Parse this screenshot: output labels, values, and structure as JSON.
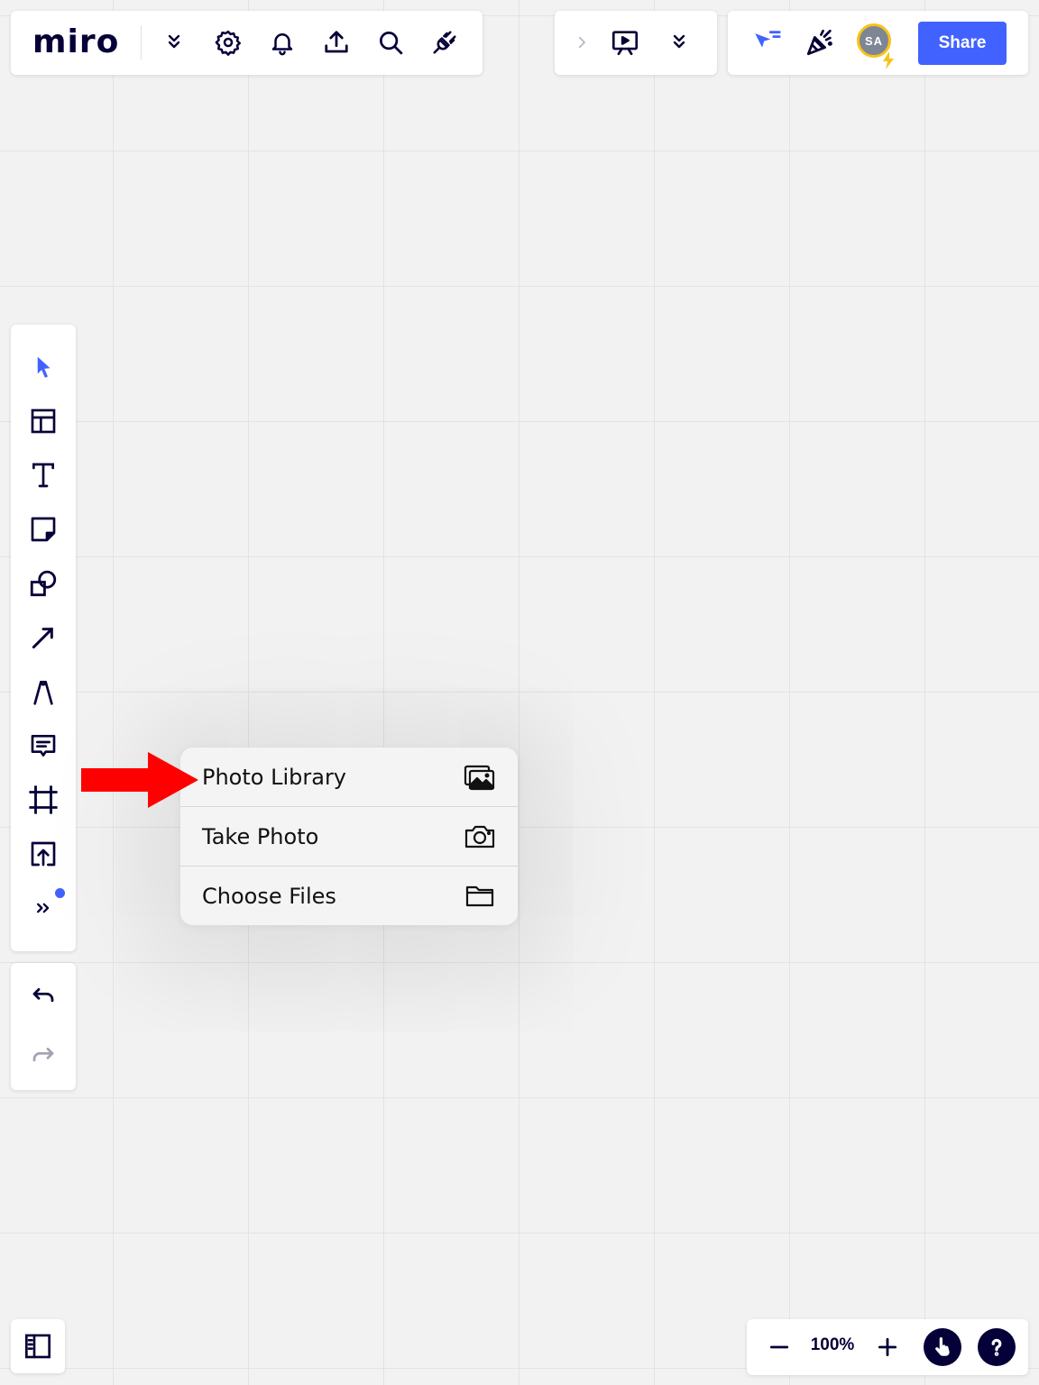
{
  "topbar": {
    "logo": "miro",
    "icons": [
      "chevrons-down-icon",
      "settings-gear-icon",
      "bell-icon",
      "upload-icon",
      "search-icon",
      "plug-icon"
    ]
  },
  "presentation": {
    "icons": [
      "chevron-right-icon",
      "presentation-play-icon",
      "chevrons-down-icon"
    ]
  },
  "collab": {
    "icons": [
      "cursor-tracking-icon",
      "celebration-icon"
    ],
    "avatar_initials": "SA",
    "share_label": "Share"
  },
  "toolbar": {
    "tools": [
      "select-tool",
      "templates-tool",
      "text-tool",
      "sticky-note-tool",
      "shapes-tool",
      "connection-line-tool",
      "pen-tool",
      "comment-tool",
      "frame-tool",
      "upload-tool",
      "more-tools"
    ],
    "undo": "undo",
    "redo": "redo"
  },
  "upload_menu": {
    "items": [
      {
        "label": "Photo Library",
        "icon": "photo-library-icon"
      },
      {
        "label": "Take Photo",
        "icon": "camera-icon"
      },
      {
        "label": "Choose Files",
        "icon": "folder-icon"
      }
    ]
  },
  "zoom": {
    "value": "100%"
  },
  "colors": {
    "accent": "#4262ff",
    "ink": "#050038",
    "avatar_ring": "#f7c31a",
    "annotation_arrow": "#ff0000"
  }
}
